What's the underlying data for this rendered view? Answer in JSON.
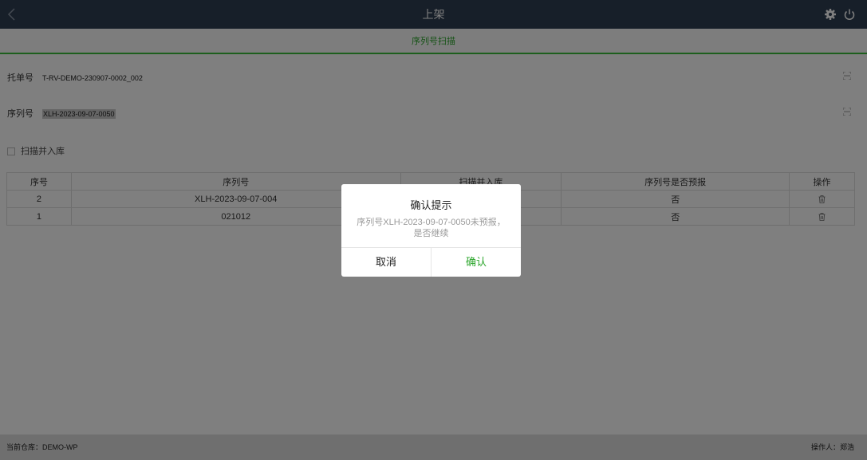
{
  "header": {
    "title": "上架"
  },
  "subtab": {
    "label": "序列号扫描"
  },
  "form": {
    "pallet_label": "托单号",
    "pallet_value": "T-RV-DEMO-230907-0002_002",
    "serial_label": "序列号",
    "serial_value": "XLH-2023-09-07-0050",
    "scan_store_label": "扫描并入库"
  },
  "table": {
    "headers": [
      "序号",
      "序列号",
      "扫描并入库",
      "序列号是否预报",
      "操作"
    ],
    "rows": [
      {
        "idx": "2",
        "serial": "XLH-2023-09-07-004",
        "stored": "",
        "forecast": "否"
      },
      {
        "idx": "1",
        "serial": "021012",
        "stored": "",
        "forecast": "否"
      }
    ]
  },
  "footer": {
    "warehouse": "当前仓库：DEMO-WP",
    "operator": "操作人：郑浩"
  },
  "dialog": {
    "title": "确认提示",
    "message": "序列号XLH-2023-09-07-0050未预报，是否继续",
    "cancel": "取消",
    "confirm": "确认"
  },
  "colors": {
    "accent": "#2aa52a",
    "topbar": "#2f3e52"
  }
}
